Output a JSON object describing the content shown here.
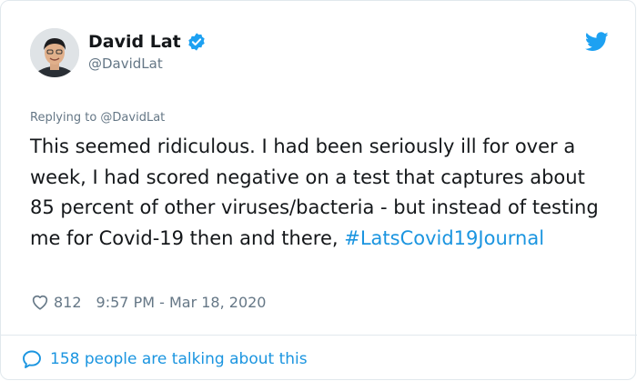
{
  "author": {
    "name": "David Lat",
    "handle": "@DavidLat"
  },
  "reply_context": "Replying to @DavidLat",
  "tweet": {
    "text": "This seemed ridiculous. I had been seriously ill for over a week, I had scored negative on a test that captures about 85 percent of other viruses/bacteria - but instead of testing me for Covid-19 then and there,",
    "hashtag": "#LatsCovid19Journal"
  },
  "meta": {
    "likes": "812",
    "timestamp": "9:57 PM - Mar 18, 2020"
  },
  "footer": {
    "talking": "158 people are talking about this"
  },
  "colors": {
    "link": "#1b95e0",
    "muted": "#657786",
    "text": "#14171a",
    "border": "#e1e8ed"
  },
  "icons": [
    "verified-badge-icon",
    "twitter-bird-icon",
    "heart-icon",
    "speech-bubble-icon"
  ]
}
